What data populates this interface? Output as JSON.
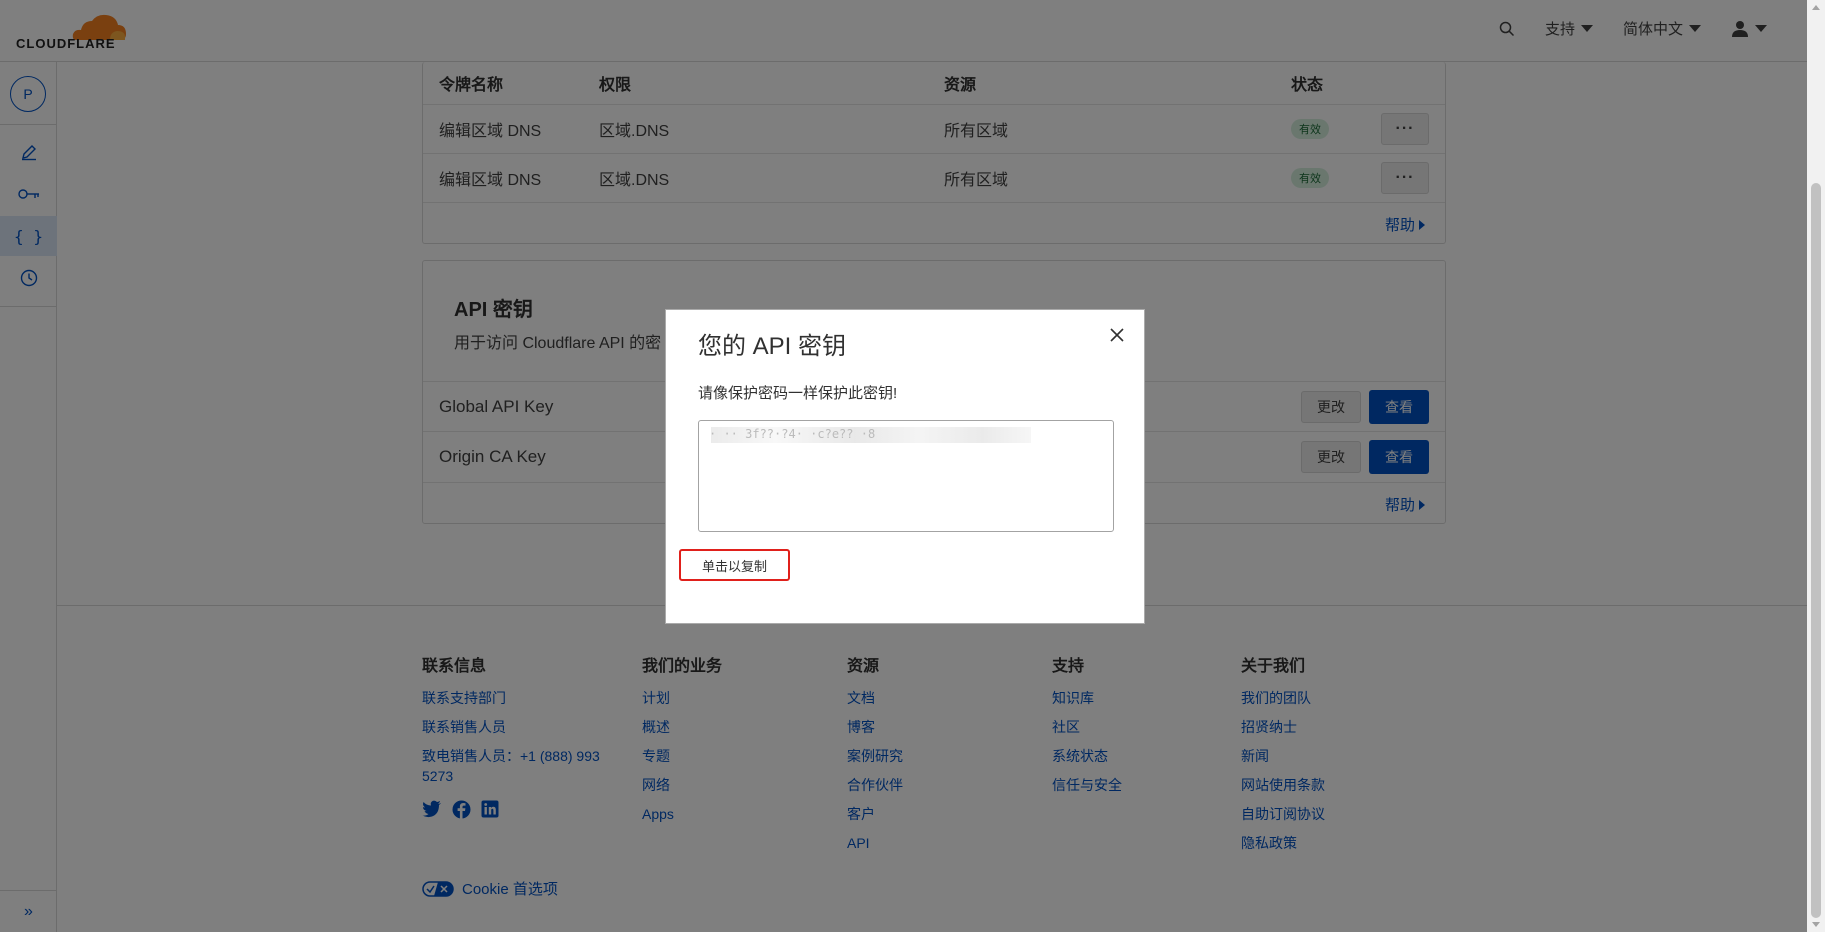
{
  "brand": {
    "name": "CLOUDFLARE",
    "accent": "#0051c3",
    "logo_orange": "#f48120"
  },
  "topbar": {
    "support_label": "支持",
    "language_label": "简体中文"
  },
  "sidebar": {
    "account_initial": "P"
  },
  "tokens_table": {
    "columns": [
      "令牌名称",
      "权限",
      "资源",
      "状态"
    ],
    "rows": [
      {
        "name": "编辑区域 DNS",
        "permission": "区域.DNS",
        "resource": "所有区域",
        "status": "有效",
        "more": "···"
      },
      {
        "name": "编辑区域 DNS",
        "permission": "区域.DNS",
        "resource": "所有区域",
        "status": "有效",
        "more": "···"
      }
    ],
    "help_label": "帮助"
  },
  "api_keys": {
    "title": "API 密钥",
    "description": "用于访问 Cloudflare API 的密",
    "rows": [
      {
        "label": "Global API Key",
        "change_label": "更改",
        "view_label": "查看"
      },
      {
        "label": "Origin CA Key",
        "change_label": "更改",
        "view_label": "查看"
      }
    ],
    "help_label": "帮助"
  },
  "modal": {
    "title": "您的 API 密钥",
    "warning": "请像保护密码一样保护此密钥!",
    "key_visible_fragments": "· ·· 3f??·?4·       ·c?e??       ·8",
    "copy_label": "单击以复制"
  },
  "footer": {
    "contact": {
      "title": "联系信息",
      "links": [
        "联系支持部门",
        "联系销售人员",
        "致电销售人员：+1 (888) 993 5273"
      ]
    },
    "business": {
      "title": "我们的业务",
      "links": [
        "计划",
        "概述",
        "专题",
        "网络",
        "Apps"
      ]
    },
    "resources": {
      "title": "资源",
      "links": [
        "文档",
        "博客",
        "案例研究",
        "合作伙伴",
        "客户",
        "API"
      ]
    },
    "support": {
      "title": "支持",
      "links": [
        "知识库",
        "社区",
        "系统状态",
        "信任与安全"
      ]
    },
    "about": {
      "title": "关于我们",
      "links": [
        "我们的团队",
        "招贤纳士",
        "新闻",
        "网站使用条款",
        "自助订阅协议",
        "隐私政策"
      ]
    },
    "cookie_label": "Cookie 首选项"
  }
}
